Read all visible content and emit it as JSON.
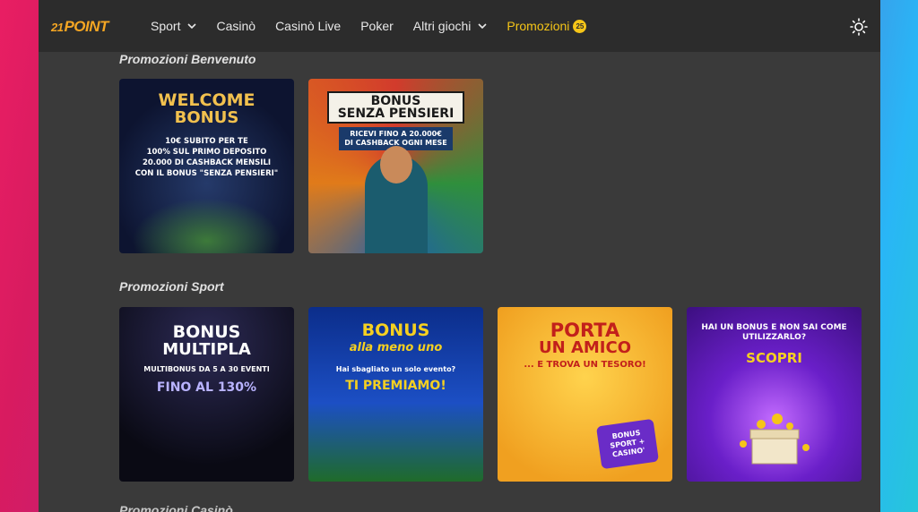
{
  "brand": {
    "logo_num": "21",
    "logo_text": "POINT"
  },
  "nav": {
    "items": [
      {
        "label": "Sport",
        "has_dropdown": true
      },
      {
        "label": "Casinò",
        "has_dropdown": false
      },
      {
        "label": "Casinò Live",
        "has_dropdown": false
      },
      {
        "label": "Poker",
        "has_dropdown": false
      },
      {
        "label": "Altri giochi",
        "has_dropdown": true
      },
      {
        "label": "Promozioni",
        "badge": "25",
        "active": true
      }
    ],
    "theme_icon": "sun-icon"
  },
  "sections": [
    {
      "title": "Promozioni Benvenuto",
      "cards": [
        {
          "heading1": "WELCOME",
          "heading2": "BONUS",
          "lines": [
            "10€ SUBITO PER TE",
            "100% SUL PRIMO DEPOSITO",
            "20.000 DI CASHBACK MENSILI",
            "CON IL BONUS \"SENZA PENSIERI\""
          ]
        },
        {
          "heading1": "BONUS",
          "heading2": "SENZA PENSIERI",
          "lines": [
            "RICEVI FINO A 20.000€",
            "DI CASHBACK OGNI MESE"
          ]
        }
      ]
    },
    {
      "title": "Promozioni Sport",
      "cards": [
        {
          "heading1": "BONUS",
          "heading2": "MULTIPLA",
          "small": "MULTIBONUS DA 5 A 30 EVENTI",
          "highlight": "FINO AL 130%"
        },
        {
          "heading1": "BONUS",
          "heading2": "alla meno uno",
          "small": "Hai sbagliato un solo evento?",
          "highlight": "TI PREMIAMO!"
        },
        {
          "heading1": "PORTA",
          "heading2": "UN AMICO",
          "small": "... E TROVA UN TESORO!",
          "sticker": [
            "BONUS",
            "SPORT +",
            "CASINO'"
          ]
        },
        {
          "small": "HAI UN BONUS E NON SAI COME UTILIZZARLO?",
          "highlight": "SCOPRI"
        }
      ]
    },
    {
      "title": "Promozioni Casinò"
    }
  ],
  "colors": {
    "accent": "#f5c518",
    "brand": "#f5a623",
    "window_bg": "#3a3a3a",
    "topbar_bg": "#2c2c2c"
  }
}
